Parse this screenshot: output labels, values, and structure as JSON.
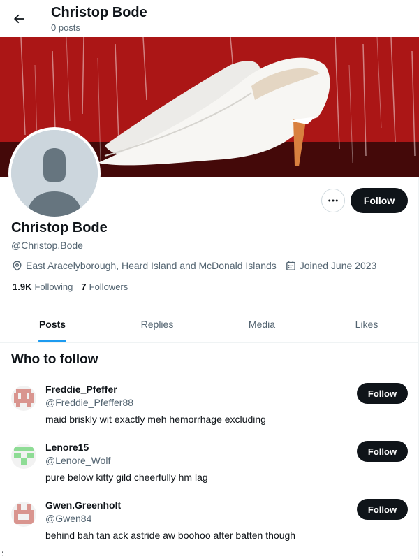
{
  "header": {
    "name": "Christop Bode",
    "posts_count": "0 posts"
  },
  "profile": {
    "display_name": "Christop Bode",
    "handle": "@Christop.Bode",
    "location": "East Aracelyborough, Heard Island and McDonald Islands",
    "joined": "Joined June 2023",
    "following_count": "1.9K",
    "following_label": "Following",
    "followers_count": "7",
    "followers_label": "Followers",
    "follow_label": "Follow"
  },
  "tabs": [
    {
      "label": "Posts",
      "active": true
    },
    {
      "label": "Replies",
      "active": false
    },
    {
      "label": "Media",
      "active": false
    },
    {
      "label": "Likes",
      "active": false
    }
  ],
  "who_to_follow": {
    "title": "Who to follow",
    "users": [
      {
        "name": "Freddie_Pfeffer",
        "handle": "@Freddie_Pfeffer88",
        "bio": "maid briskly wit exactly meh hemorrhage excluding",
        "follow_label": "Follow",
        "avatar_color": "#d9958f"
      },
      {
        "name": "Lenore15",
        "handle": "@Lenore_Wolf",
        "bio": "pure below kitty gild cheerfully hm lag",
        "follow_label": "Follow",
        "avatar_color": "#8edc95"
      },
      {
        "name": "Gwen.Greenholt",
        "handle": "@Gwen84",
        "bio": "behind bah tan ack astride aw boohoo after batten though",
        "follow_label": "Follow",
        "avatar_color": "#d9958f"
      }
    ]
  },
  "stray_char": ":",
  "colors": {
    "accent": "#1d9bf0",
    "primary_button": "#0f1419",
    "secondary_text": "#536471"
  }
}
